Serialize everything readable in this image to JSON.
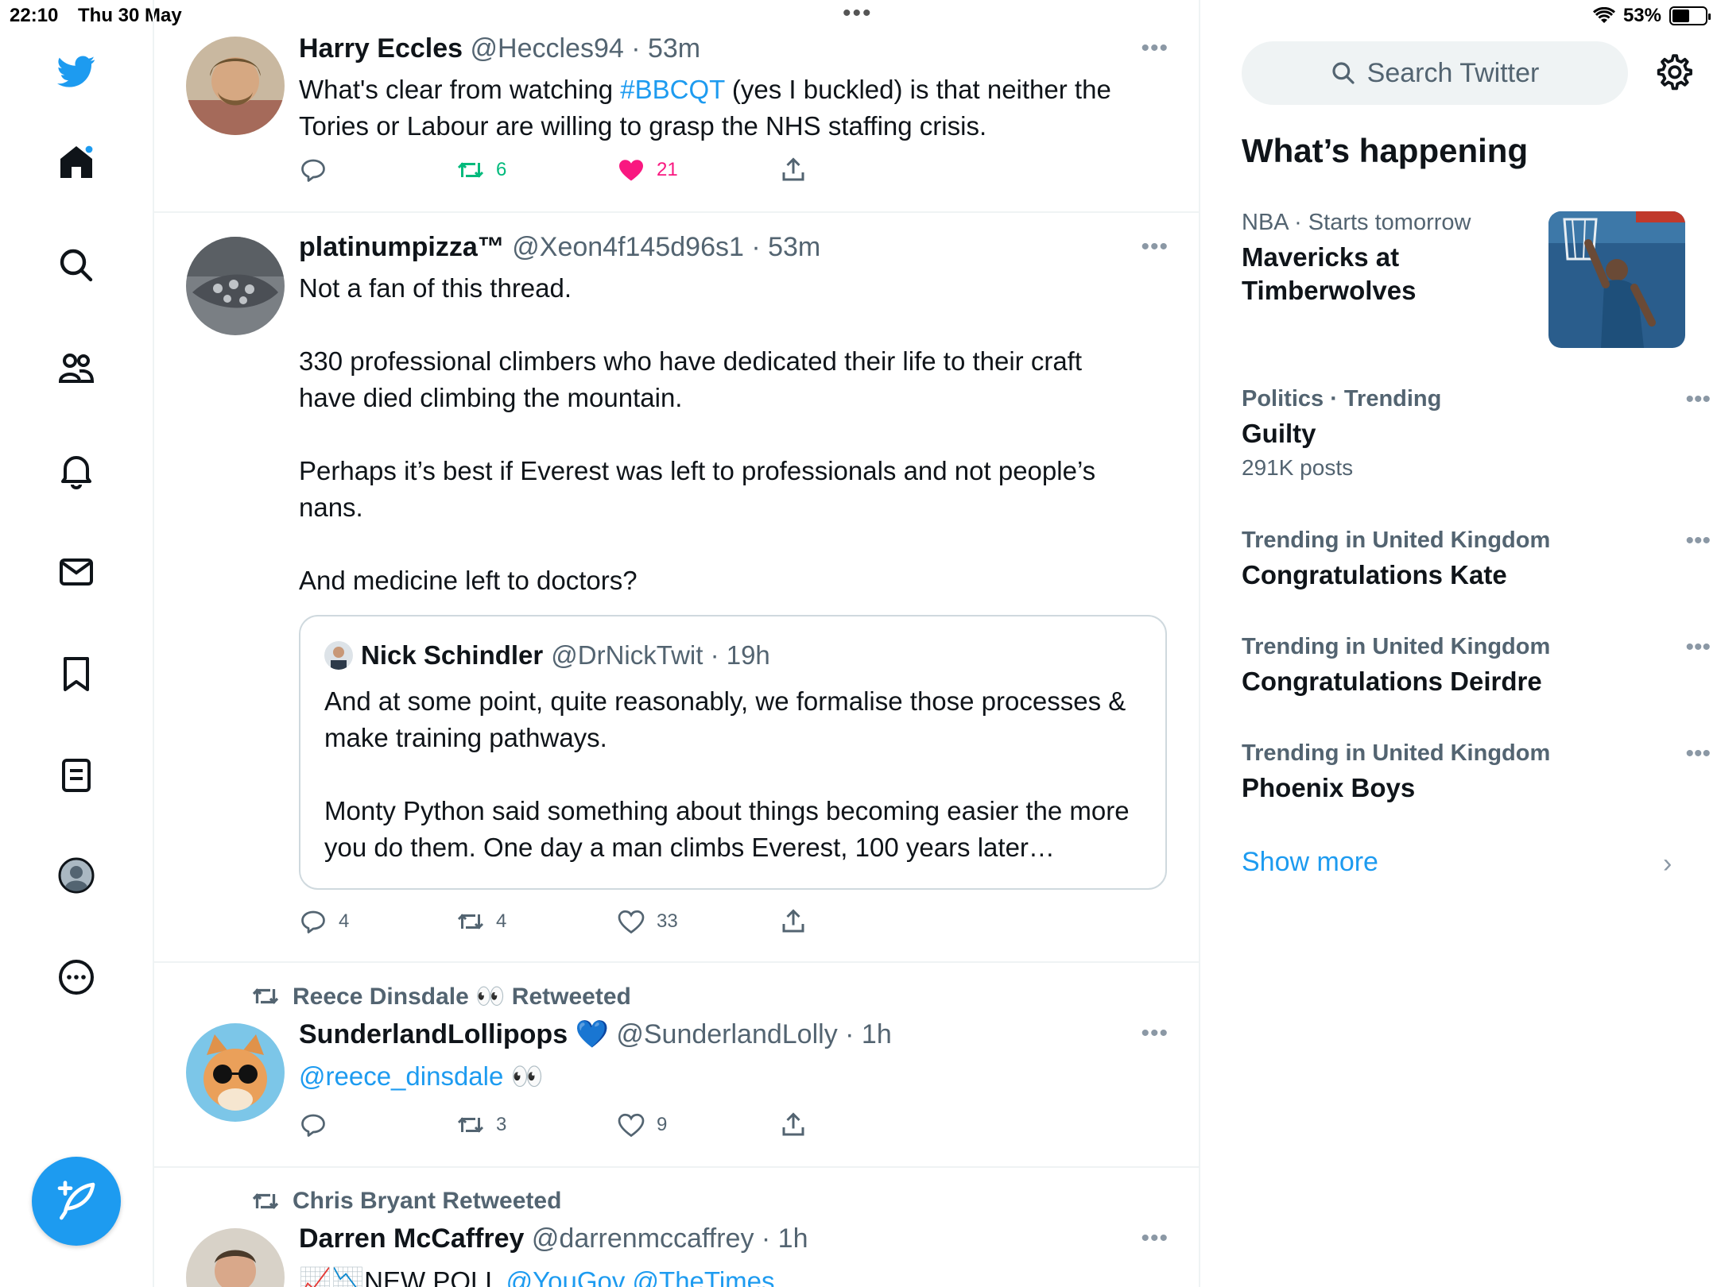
{
  "status_bar": {
    "time": "22:10",
    "date": "Thu 30 May",
    "battery": "53%",
    "battery_level": 0.53
  },
  "nav": {
    "icons": [
      "twitter-logo-icon",
      "home-icon",
      "search-icon",
      "communities-icon",
      "notifications-icon",
      "messages-icon",
      "bookmarks-icon",
      "lists-icon",
      "profile-icon",
      "more-icon"
    ],
    "compose": "compose-tweet-icon"
  },
  "tweets": [
    {
      "name": "Harry Eccles",
      "handle": "@Heccles94 · 53m",
      "text_before": "What's clear from watching ",
      "hashtag": "#BBCQT",
      "text_after": " (yes I buckled) is that neither the Tories or Labour are willing to grasp the NHS staffing crisis.",
      "replies": "",
      "retweets": "6",
      "likes": "21"
    },
    {
      "name": "platinumpizza™",
      "handle": "@Xeon4f145d96s1 · 53m",
      "paragraphs": [
        "Not a fan of this thread.",
        "330 professional climbers who have dedicated their life to their craft have died climbing the mountain.",
        "Perhaps it’s best if Everest was left to professionals and not people’s nans.",
        "And medicine left to doctors?"
      ],
      "quote": {
        "name": "Nick Schindler",
        "handle": "@DrNickTwit · 19h",
        "paragraphs": [
          "And at some point, quite reasonably, we formalise those processes & make training pathways.",
          "Monty Python said something about things becoming easier the more you do them. One day a man climbs Everest, 100 years later…"
        ]
      },
      "replies": "4",
      "retweets": "4",
      "likes": "33"
    },
    {
      "retweeted_by": "Reece Dinsdale 👀 Retweeted",
      "name": "SunderlandLollipops 💙",
      "handle": "@SunderlandLolly · 1h",
      "mention": "@reece_dinsdale",
      "text_after": " 👀",
      "replies": "",
      "retweets": "3",
      "likes": "9"
    },
    {
      "retweeted_by": "Chris Bryant Retweeted",
      "name": "Darren McCaffrey",
      "handle": "@darrenmccaffrey · 1h",
      "text_before": "📈📉NEW POLL ",
      "mention": "@YouGov @TheTimes"
    }
  ],
  "sidebar": {
    "search_placeholder": "Search Twitter",
    "heading": "What’s happening",
    "trends": [
      {
        "meta": "NBA · Starts tomorrow",
        "title": "Mavericks at Timberwolves",
        "count": ""
      },
      {
        "meta": "Politics · Trending",
        "title": "Guilty",
        "count": "291K posts"
      },
      {
        "meta": "Trending in United Kingdom",
        "title": "Congratulations Kate",
        "count": ""
      },
      {
        "meta": "Trending in United Kingdom",
        "title": "Congratulations Deirdre",
        "count": ""
      },
      {
        "meta": "Trending in United Kingdom",
        "title": "Phoenix Boys",
        "count": ""
      }
    ],
    "show_more": "Show more"
  },
  "colors": {
    "accent": "#1d9bf0",
    "like": "#f91880",
    "retweet": "#00ba7c",
    "text": "#0f1419",
    "muted": "#536471"
  }
}
